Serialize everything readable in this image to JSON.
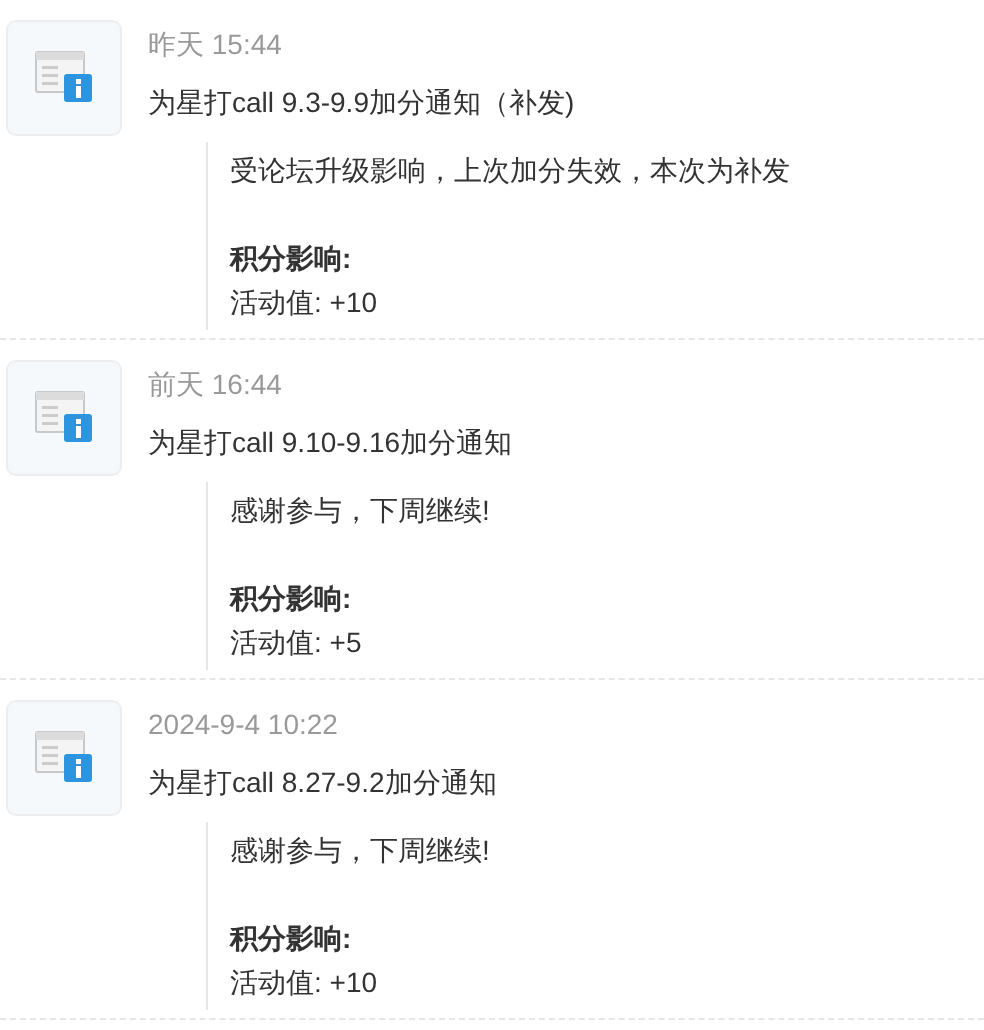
{
  "notices": [
    {
      "time": "昨天 15:44",
      "title": "为星打call 9.3-9.9加分通知（补发)",
      "message": "受论坛升级影响，上次加分失效，本次为补发",
      "effect_label": "积分影响:",
      "effect_value": "活动值: +10"
    },
    {
      "time": "前天 16:44",
      "title": "为星打call 9.10-9.16加分通知",
      "message": "感谢参与，下周继续!",
      "effect_label": "积分影响:",
      "effect_value": "活动值: +5"
    },
    {
      "time": "2024-9-4 10:22",
      "title": "为星打call 8.27-9.2加分通知",
      "message": "感谢参与，下周继续!",
      "effect_label": "积分影响:",
      "effect_value": "活动值: +10"
    }
  ]
}
